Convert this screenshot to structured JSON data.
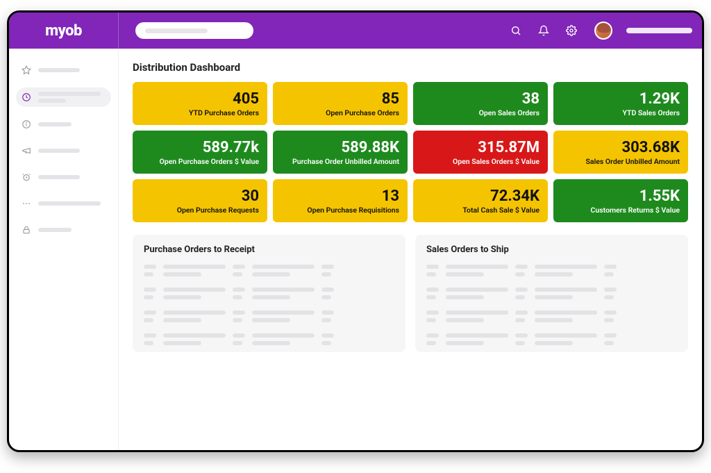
{
  "brand": "myob",
  "page_title": "Distribution Dashboard",
  "colors": {
    "primary": "#8126B8",
    "yellow": "#F5C400",
    "green": "#1E8A1E",
    "red": "#D81818"
  },
  "header_icons": [
    "search",
    "bell",
    "gear"
  ],
  "sidebar": {
    "items": [
      {
        "icon": "star",
        "active": false
      },
      {
        "icon": "clock",
        "active": true
      },
      {
        "icon": "info",
        "active": false
      },
      {
        "icon": "announce",
        "active": false
      },
      {
        "icon": "alarm",
        "active": false
      },
      {
        "icon": "more",
        "active": false
      },
      {
        "icon": "lock",
        "active": false
      }
    ]
  },
  "kpis": [
    {
      "value": "405",
      "label": "YTD Purchase Orders",
      "color": "yellow"
    },
    {
      "value": "85",
      "label": "Open Purchase Orders",
      "color": "yellow"
    },
    {
      "value": "38",
      "label": "Open Sales Orders",
      "color": "green"
    },
    {
      "value": "1.29K",
      "label": "YTD Sales Orders",
      "color": "green"
    },
    {
      "value": "589.77k",
      "label": "Open Purchase Orders $ Value",
      "color": "green"
    },
    {
      "value": "589.88K",
      "label": "Purchase Order Unbilled Amount",
      "color": "green"
    },
    {
      "value": "315.87M",
      "label": "Open Sales Orders $ Value",
      "color": "red"
    },
    {
      "value": "303.68K",
      "label": "Sales Order Unbilled Amount",
      "color": "yellow"
    },
    {
      "value": "30",
      "label": "Open Purchase Requests",
      "color": "yellow"
    },
    {
      "value": "13",
      "label": "Open Purchase Requisitions",
      "color": "yellow"
    },
    {
      "value": "72.34K",
      "label": "Total Cash Sale $ Value",
      "color": "yellow"
    },
    {
      "value": "1.55K",
      "label": "Customers Returns $ Value",
      "color": "green"
    }
  ],
  "panels": [
    {
      "title": "Purchase  Orders to Receipt"
    },
    {
      "title": "Sales Orders to Ship"
    }
  ]
}
